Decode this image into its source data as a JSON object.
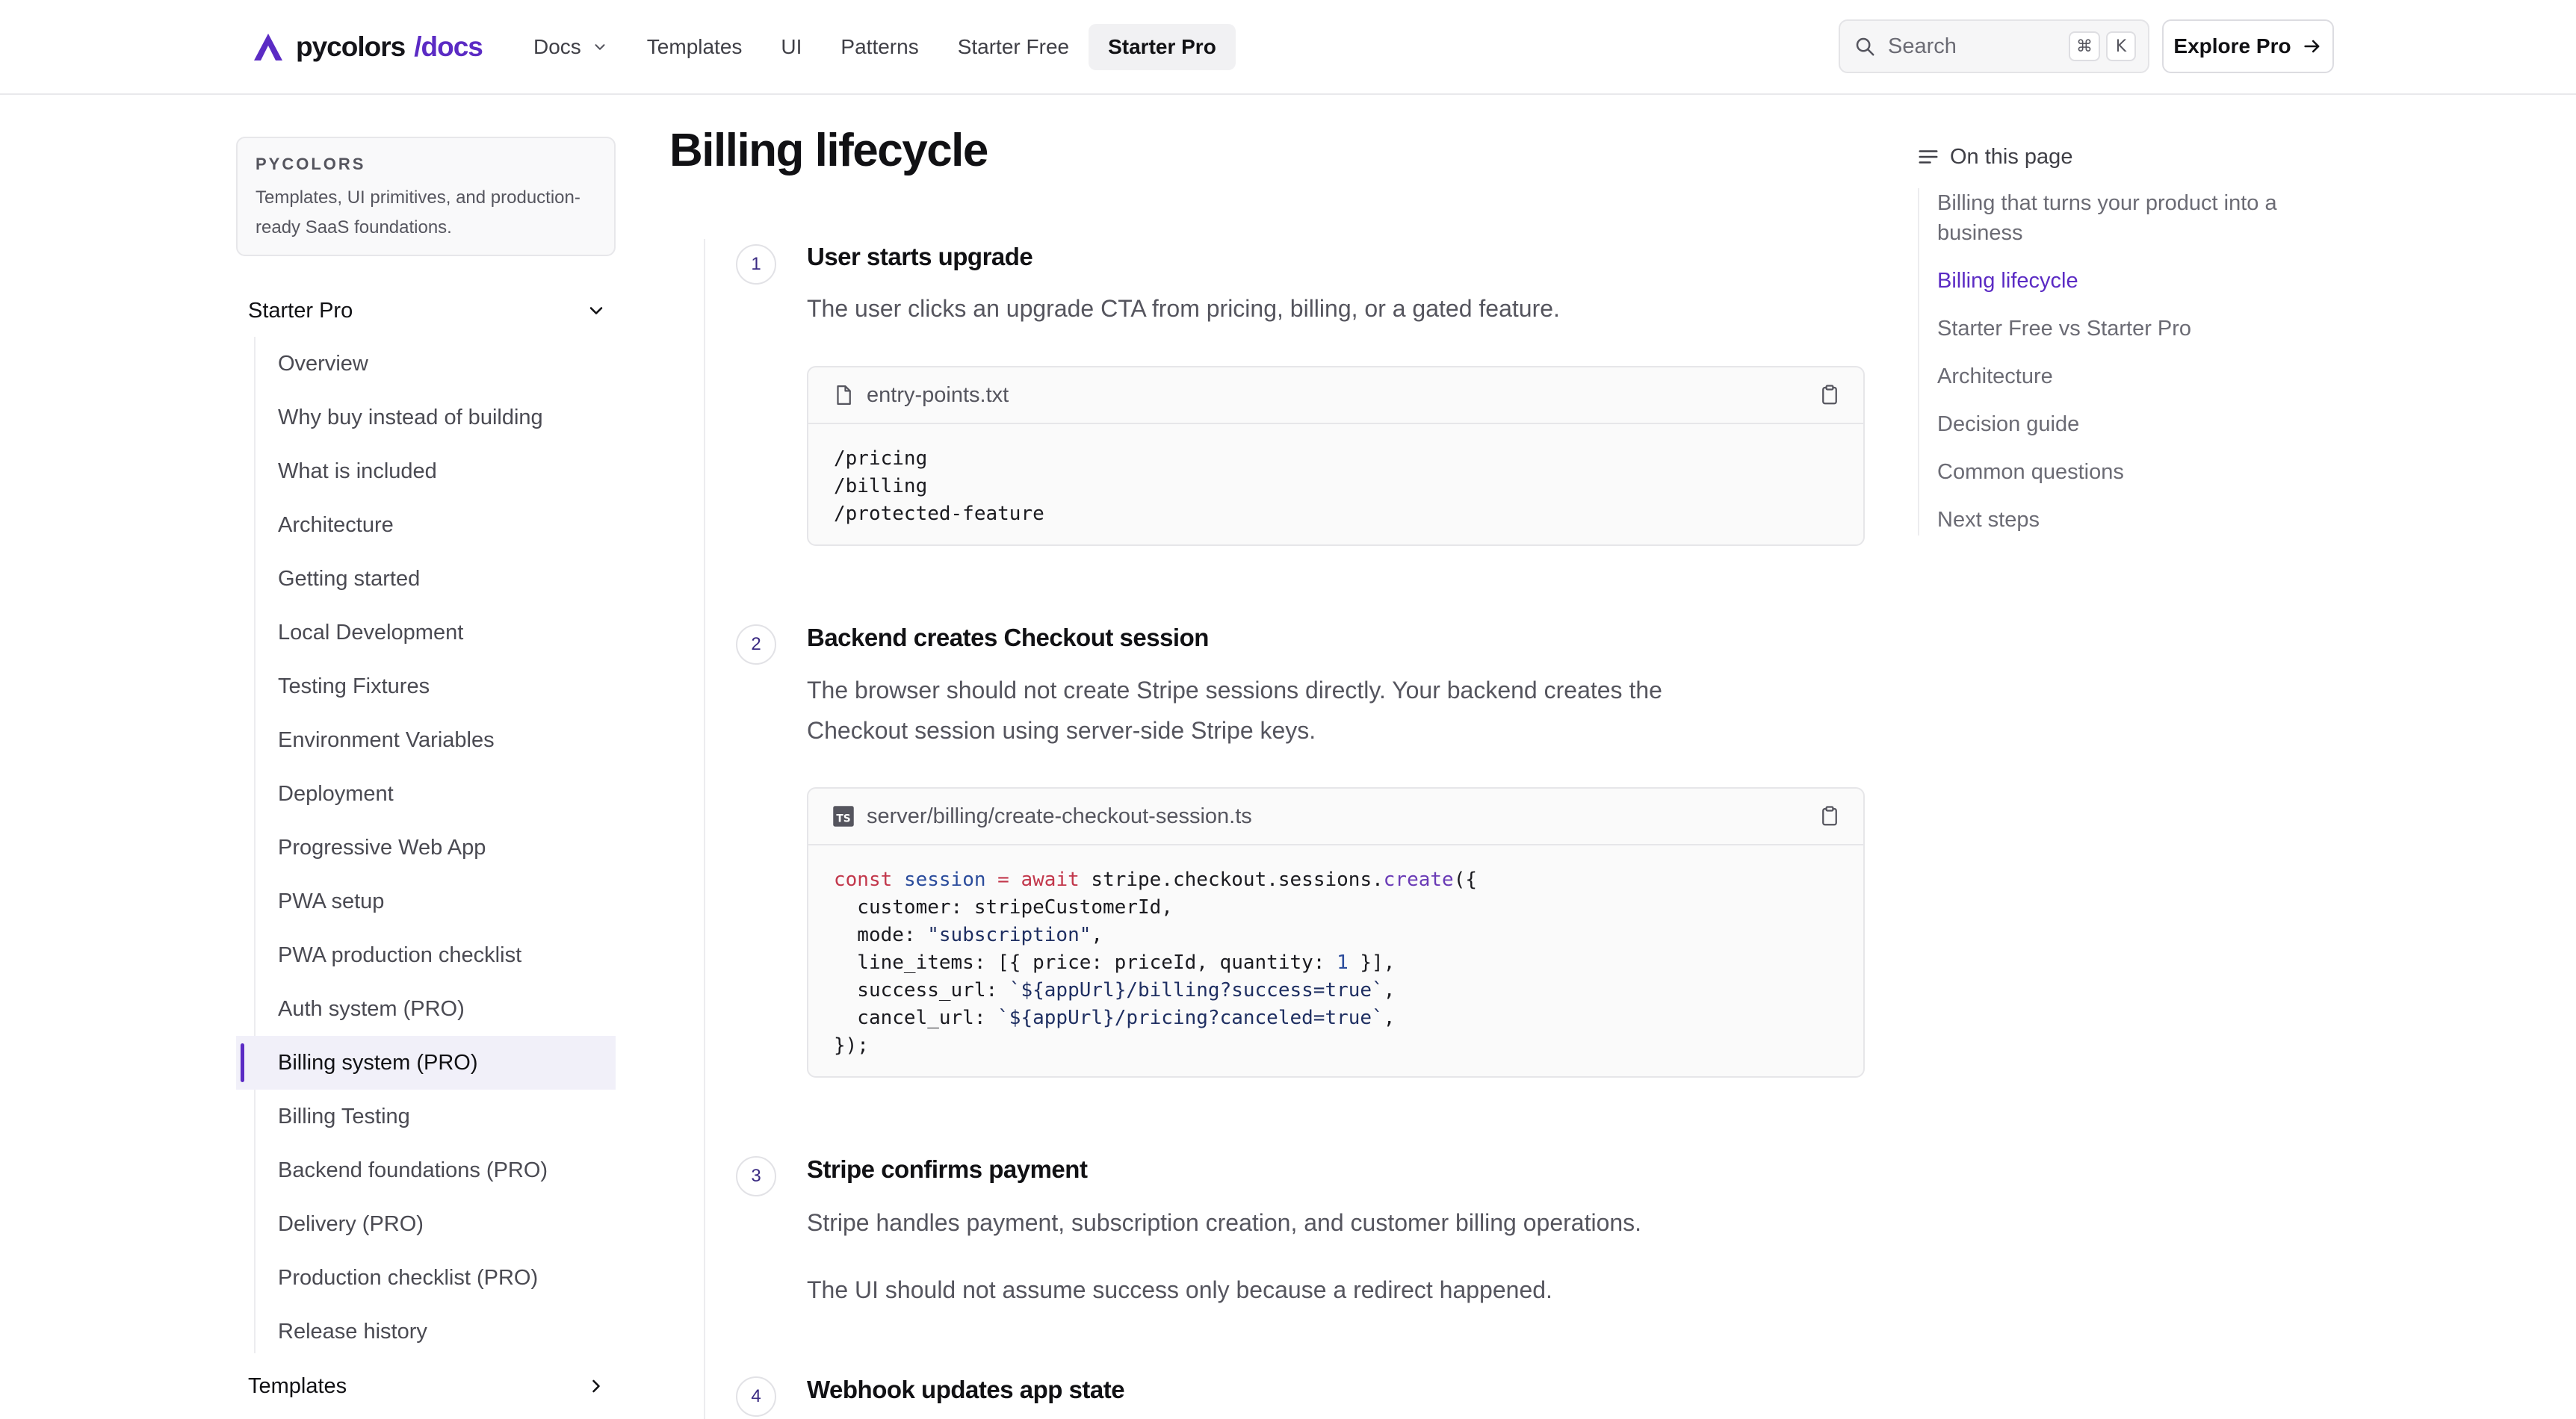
{
  "header": {
    "logo_name": "pycolors",
    "logo_suffix": "/docs",
    "nav": [
      {
        "label": "Docs",
        "dropdown": true
      },
      {
        "label": "Templates"
      },
      {
        "label": "UI"
      },
      {
        "label": "Patterns"
      },
      {
        "label": "Starter Free"
      },
      {
        "label": "Starter Pro",
        "active": true
      }
    ],
    "search": {
      "placeholder": "Search",
      "kbd_mod": "⌘",
      "kbd_key": "K"
    },
    "cta": "Explore Pro"
  },
  "sidebar": {
    "brand": {
      "eyebrow": "PYCOLORS",
      "description": "Templates, UI primitives, and production-ready SaaS foundations."
    },
    "section": "Starter Pro",
    "items": [
      "Overview",
      "Why buy instead of building",
      "What is included",
      "Architecture",
      "Getting started",
      "Local Development",
      "Testing Fixtures",
      "Environment Variables",
      "Deployment",
      "Progressive Web App",
      "PWA setup",
      "PWA production checklist",
      "Auth system (PRO)",
      "Billing system (PRO)",
      "Billing Testing",
      "Backend foundations (PRO)",
      "Delivery (PRO)",
      "Production checklist (PRO)",
      "Release history"
    ],
    "active_item": "Billing system (PRO)",
    "next_section": "Templates"
  },
  "main": {
    "title": "Billing lifecycle",
    "steps": [
      {
        "number": "1",
        "title": "User starts upgrade",
        "text": "The user clicks an upgrade CTA from pricing, billing, or a gated feature.",
        "code": {
          "filename": "entry-points.txt",
          "lines": [
            "/pricing",
            "/billing",
            "/protected-feature"
          ]
        }
      },
      {
        "number": "2",
        "title": "Backend creates Checkout session",
        "text": "The browser should not create Stripe sessions directly. Your backend creates the Checkout session using server-side Stripe keys.",
        "code": {
          "filename": "server/billing/create-checkout-session.ts",
          "lines": [
            "const session = await stripe.checkout.sessions.create({",
            "  customer: stripeCustomerId,",
            "  mode: \"subscription\",",
            "  line_items: [{ price: priceId, quantity: 1 }],",
            "  success_url: `${appUrl}/billing?success=true`,",
            "  cancel_url: `${appUrl}/pricing?canceled=true`,",
            "});"
          ]
        }
      },
      {
        "number": "3",
        "title": "Stripe confirms payment",
        "text": "Stripe handles payment, subscription creation, and customer billing operations.",
        "text2": "The UI should not assume success only because a redirect happened."
      },
      {
        "number": "4",
        "title": "Webhook updates app state"
      }
    ]
  },
  "toc": {
    "title": "On this page",
    "items": [
      "Billing that turns your product into a business",
      "Billing lifecycle",
      "Starter Free vs Starter Pro",
      "Architecture",
      "Decision guide",
      "Common questions",
      "Next steps"
    ],
    "active_item": "Billing lifecycle"
  },
  "colors": {
    "accent": "#5b2bc4",
    "text": "#111114",
    "muted": "#55555e",
    "border": "#e6e6e9"
  }
}
